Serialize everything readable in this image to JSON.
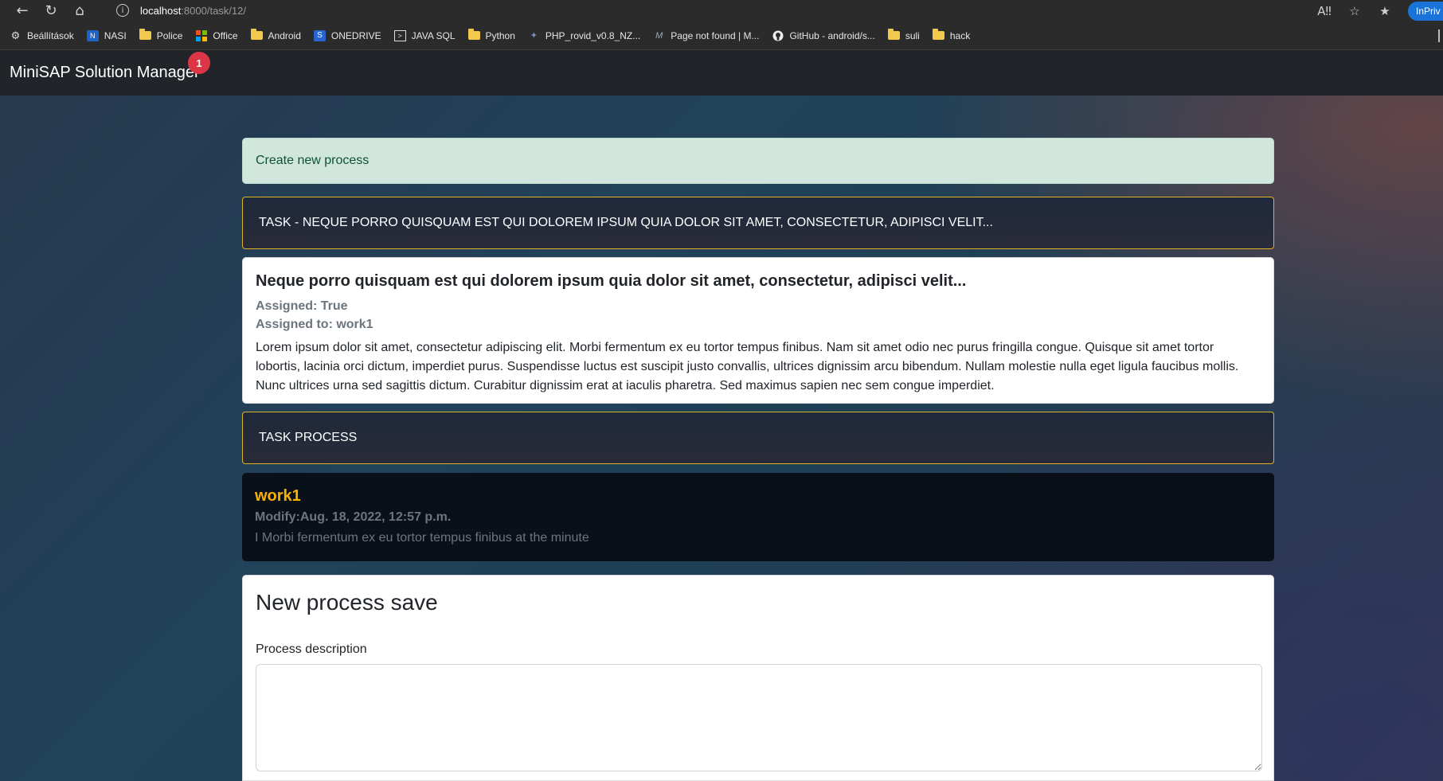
{
  "browser": {
    "url_host": "localhost",
    "url_path": ":8000/task/12/",
    "inprivate_label": "InPriv",
    "bookmarks": [
      {
        "label": "Beállítások",
        "icon": "gear-icon"
      },
      {
        "label": "NASI",
        "icon": "nasi-icon"
      },
      {
        "label": "Police",
        "icon": "folder-icon"
      },
      {
        "label": "Office",
        "icon": "office-icon"
      },
      {
        "label": "Android",
        "icon": "folder-icon"
      },
      {
        "label": "ONEDRIVE",
        "icon": "onedrive-icon"
      },
      {
        "label": "JAVA SQL",
        "icon": "terminal-icon"
      },
      {
        "label": "Python",
        "icon": "folder-icon"
      },
      {
        "label": "PHP_rovid_v0.8_NZ...",
        "icon": "php-icon"
      },
      {
        "label": "Page not found | M...",
        "icon": "page-icon"
      },
      {
        "label": "GitHub - android/s...",
        "icon": "github-icon"
      },
      {
        "label": "suli",
        "icon": "folder-icon"
      },
      {
        "label": "hack",
        "icon": "folder-icon"
      }
    ]
  },
  "navbar": {
    "brand": "MiniSAP Solution Manager",
    "badge_count": "1"
  },
  "alert": {
    "text": "Create new process"
  },
  "task_header": {
    "text": "TASK - NEQUE PORRO QUISQUAM EST QUI DOLOREM IPSUM QUIA DOLOR SIT AMET, CONSECTETUR, ADIPISCI VELIT..."
  },
  "task": {
    "title": "Neque porro quisquam est qui dolorem ipsum quia dolor sit amet, consectetur, adipisci velit...",
    "assigned": "Assigned: True",
    "assigned_to": "Assigned to: work1",
    "description": "Lorem ipsum dolor sit amet, consectetur adipiscing elit. Morbi fermentum ex eu tortor tempus finibus. Nam sit amet odio nec purus fringilla congue. Quisque sit amet tortor lobortis, lacinia orci dictum, imperdiet purus. Suspendisse luctus est suscipit justo convallis, ultrices dignissim arcu bibendum. Nullam molestie nulla eget ligula faucibus mollis. Nunc ultrices urna sed sagittis dictum. Curabitur dignissim erat at iaculis pharetra. Sed maximus sapien nec sem congue imperdiet."
  },
  "process_header": {
    "text": "TASK PROCESS"
  },
  "process": {
    "user": "work1",
    "modified": "Modify:Aug. 18, 2022, 12:57 p.m.",
    "text": "I Morbi fermentum ex eu tortor tempus finibus at the minute"
  },
  "form": {
    "title": "New process save",
    "label": "Process description",
    "value": ""
  },
  "colors": {
    "accent_yellow": "#f5b301",
    "alert_bg": "#d1e7dd",
    "badge_red": "#dc3545",
    "header_border": "#e0b324"
  }
}
